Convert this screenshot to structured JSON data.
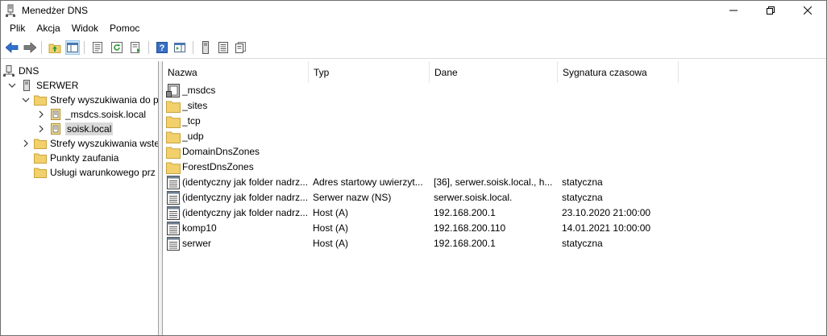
{
  "window": {
    "title": "Menedżer DNS"
  },
  "menu": [
    "Plik",
    "Akcja",
    "Widok",
    "Pomoc"
  ],
  "tree": {
    "root": "DNS",
    "server": "SERWER",
    "forward_zones": "Strefy wyszukiwania do p",
    "zone_msdcs": "_msdcs.soisk.local",
    "zone_soisk": "soisk.local",
    "reverse_zones": "Strefy wyszukiwania wste",
    "trust_points": "Punkty zaufania",
    "conditional_forwarders": "Usługi warunkowego prz"
  },
  "columns": {
    "name": "Nazwa",
    "type": "Typ",
    "data": "Dane",
    "timestamp": "Sygnatura czasowa"
  },
  "records": [
    {
      "name": "_msdcs",
      "type": "",
      "data": "",
      "timestamp": "",
      "icon": "zone-delegation-icon"
    },
    {
      "name": "_sites",
      "type": "",
      "data": "",
      "timestamp": "",
      "icon": "folder-icon"
    },
    {
      "name": "_tcp",
      "type": "",
      "data": "",
      "timestamp": "",
      "icon": "folder-icon"
    },
    {
      "name": "_udp",
      "type": "",
      "data": "",
      "timestamp": "",
      "icon": "folder-icon"
    },
    {
      "name": "DomainDnsZones",
      "type": "",
      "data": "",
      "timestamp": "",
      "icon": "folder-icon"
    },
    {
      "name": "ForestDnsZones",
      "type": "",
      "data": "",
      "timestamp": "",
      "icon": "folder-icon"
    },
    {
      "name": "(identyczny jak folder nadrz...",
      "type": "Adres startowy uwierzyt...",
      "data": "[36], serwer.soisk.local., h...",
      "timestamp": "statyczna",
      "icon": "record-icon"
    },
    {
      "name": "(identyczny jak folder nadrz...",
      "type": "Serwer nazw (NS)",
      "data": "serwer.soisk.local.",
      "timestamp": "statyczna",
      "icon": "record-icon"
    },
    {
      "name": "(identyczny jak folder nadrz...",
      "type": "Host (A)",
      "data": "192.168.200.1",
      "timestamp": "23.10.2020 21:00:00",
      "icon": "record-icon"
    },
    {
      "name": "komp10",
      "type": "Host (A)",
      "data": "192.168.200.110",
      "timestamp": "14.01.2021 10:00:00",
      "icon": "record-icon"
    },
    {
      "name": "serwer",
      "type": "Host (A)",
      "data": "192.168.200.1",
      "timestamp": "statyczna",
      "icon": "record-icon"
    }
  ],
  "colors": {
    "folder": "#f2d06b",
    "folder_border": "#c9a43a",
    "selected": "#d9d9d9",
    "back_arrow": "#2f6fd0"
  }
}
